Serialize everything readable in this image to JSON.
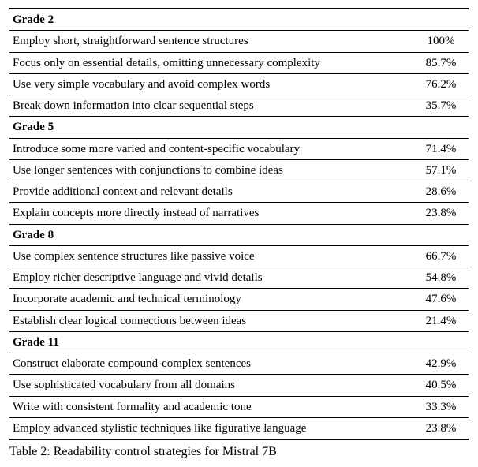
{
  "chart_data": {
    "type": "table",
    "title": "Table 2: Readability control strategies for Mistral 7B",
    "groups": [
      {
        "name": "Grade 2",
        "rows": [
          {
            "desc": "Employ short, straightforward sentence structures",
            "value": "100%"
          },
          {
            "desc": "Focus only on essential details, omitting unnecessary complexity",
            "value": "85.7%"
          },
          {
            "desc": "Use very simple vocabulary and avoid complex words",
            "value": "76.2%"
          },
          {
            "desc": "Break down information into clear sequential steps",
            "value": "35.7%"
          }
        ]
      },
      {
        "name": "Grade 5",
        "rows": [
          {
            "desc": "Introduce some more varied and content-specific vocabulary",
            "value": "71.4%"
          },
          {
            "desc": "Use longer sentences with conjunctions to combine ideas",
            "value": "57.1%"
          },
          {
            "desc": "Provide additional context and relevant details",
            "value": "28.6%"
          },
          {
            "desc": "Explain concepts more directly instead of narratives",
            "value": "23.8%"
          }
        ]
      },
      {
        "name": "Grade 8",
        "rows": [
          {
            "desc": "Use complex sentence structures like passive voice",
            "value": "66.7%"
          },
          {
            "desc": "Employ richer descriptive language and vivid details",
            "value": "54.8%"
          },
          {
            "desc": "Incorporate academic and technical terminology",
            "value": "47.6%"
          },
          {
            "desc": "Establish clear logical connections between ideas",
            "value": "21.4%"
          }
        ]
      },
      {
        "name": "Grade 11",
        "rows": [
          {
            "desc": "Construct elaborate compound-complex sentences",
            "value": "42.9%"
          },
          {
            "desc": "Use sophisticated vocabulary from all domains",
            "value": "40.5%"
          },
          {
            "desc": "Write with consistent formality and academic tone",
            "value": "33.3%"
          },
          {
            "desc": "Employ advanced stylistic techniques like figurative language",
            "value": "23.8%"
          }
        ]
      }
    ]
  },
  "caption": "Table 2: Readability control strategies for Mistral 7B"
}
